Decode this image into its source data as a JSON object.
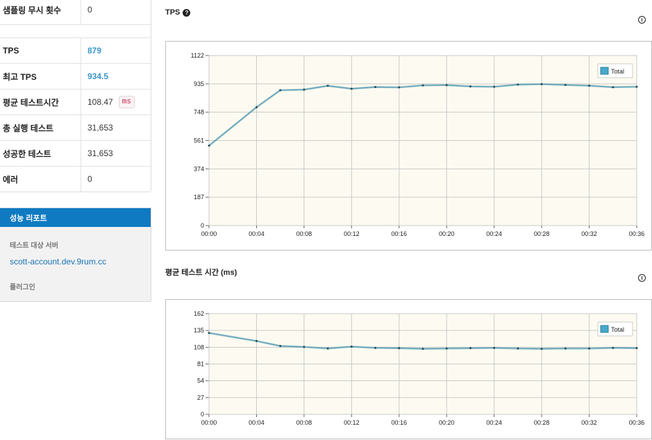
{
  "stats": [
    {
      "label": "샘플링 무시 횟수",
      "value": "0",
      "highlight": false
    },
    {
      "label": "TPS",
      "value": "879",
      "highlight": true
    },
    {
      "label": "최고 TPS",
      "value": "934.5",
      "highlight": true
    },
    {
      "label": "평균 테스트시간",
      "value": "108.47",
      "unit": "ms",
      "highlight": false
    },
    {
      "label": "총 실행 테스트",
      "value": "31,653",
      "highlight": false
    },
    {
      "label": "성공한 테스트",
      "value": "31,653",
      "highlight": false
    },
    {
      "label": "에러",
      "value": "0",
      "highlight": false
    }
  ],
  "report": {
    "title": "성능 리포트",
    "target_label": "테스트 대상 서버",
    "target_value": "scott-account.dev.9rum.cc",
    "plugin_label": "플러그인"
  },
  "chart_data": [
    {
      "type": "line",
      "title": "TPS",
      "yticks": [
        "0",
        "187",
        "374",
        "561",
        "748",
        "935",
        "1122"
      ],
      "ylim": [
        0,
        1122
      ],
      "x": [
        "00:00",
        "00:02",
        "00:04",
        "00:06",
        "00:08",
        "00:10",
        "00:12",
        "00:14",
        "00:16",
        "00:18",
        "00:20",
        "00:22",
        "00:24",
        "00:26",
        "00:28",
        "00:30",
        "00:32",
        "00:34",
        "00:36"
      ],
      "xticks": [
        "00:00",
        "00:04",
        "00:08",
        "00:12",
        "00:16",
        "00:20",
        "00:24",
        "00:28",
        "00:32",
        "00:36"
      ],
      "series": [
        {
          "name": "Total",
          "values": [
            527,
            null,
            781,
            893,
            897,
            922,
            903,
            914,
            912,
            925,
            927,
            918,
            916,
            930,
            933,
            928,
            923,
            913,
            916
          ]
        }
      ],
      "legend": "top-right",
      "grid": true
    },
    {
      "type": "line",
      "title": "평균 테스트 시간 (ms)",
      "yticks": [
        "0",
        "27",
        "54",
        "81",
        "108",
        "135",
        "162"
      ],
      "ylim": [
        0,
        162
      ],
      "x": [
        "00:00",
        "00:02",
        "00:04",
        "00:06",
        "00:08",
        "00:10",
        "00:12",
        "00:14",
        "00:16",
        "00:18",
        "00:20",
        "00:22",
        "00:24",
        "00:26",
        "00:28",
        "00:30",
        "00:32",
        "00:34",
        "00:36"
      ],
      "xticks": [
        "00:00",
        "00:04",
        "00:08",
        "00:12",
        "00:16",
        "00:20",
        "00:24",
        "00:28",
        "00:32",
        "00:36"
      ],
      "series": [
        {
          "name": "Total",
          "values": [
            131,
            null,
            118,
            110,
            108.5,
            106,
            109,
            107,
            106.5,
            105.5,
            106,
            106.5,
            107,
            106,
            105.5,
            106,
            106,
            107,
            106.5
          ]
        }
      ],
      "legend": "top-right",
      "grid": true
    }
  ],
  "colors": {
    "line": "#5b9fb6",
    "plot_bg": "#fdfbf1",
    "grid": "#c9c9c9",
    "legend_swatch": "#45a9c9",
    "accent": "#0f7ac2"
  },
  "icons": {
    "help": "question-icon",
    "download": "download-icon"
  }
}
